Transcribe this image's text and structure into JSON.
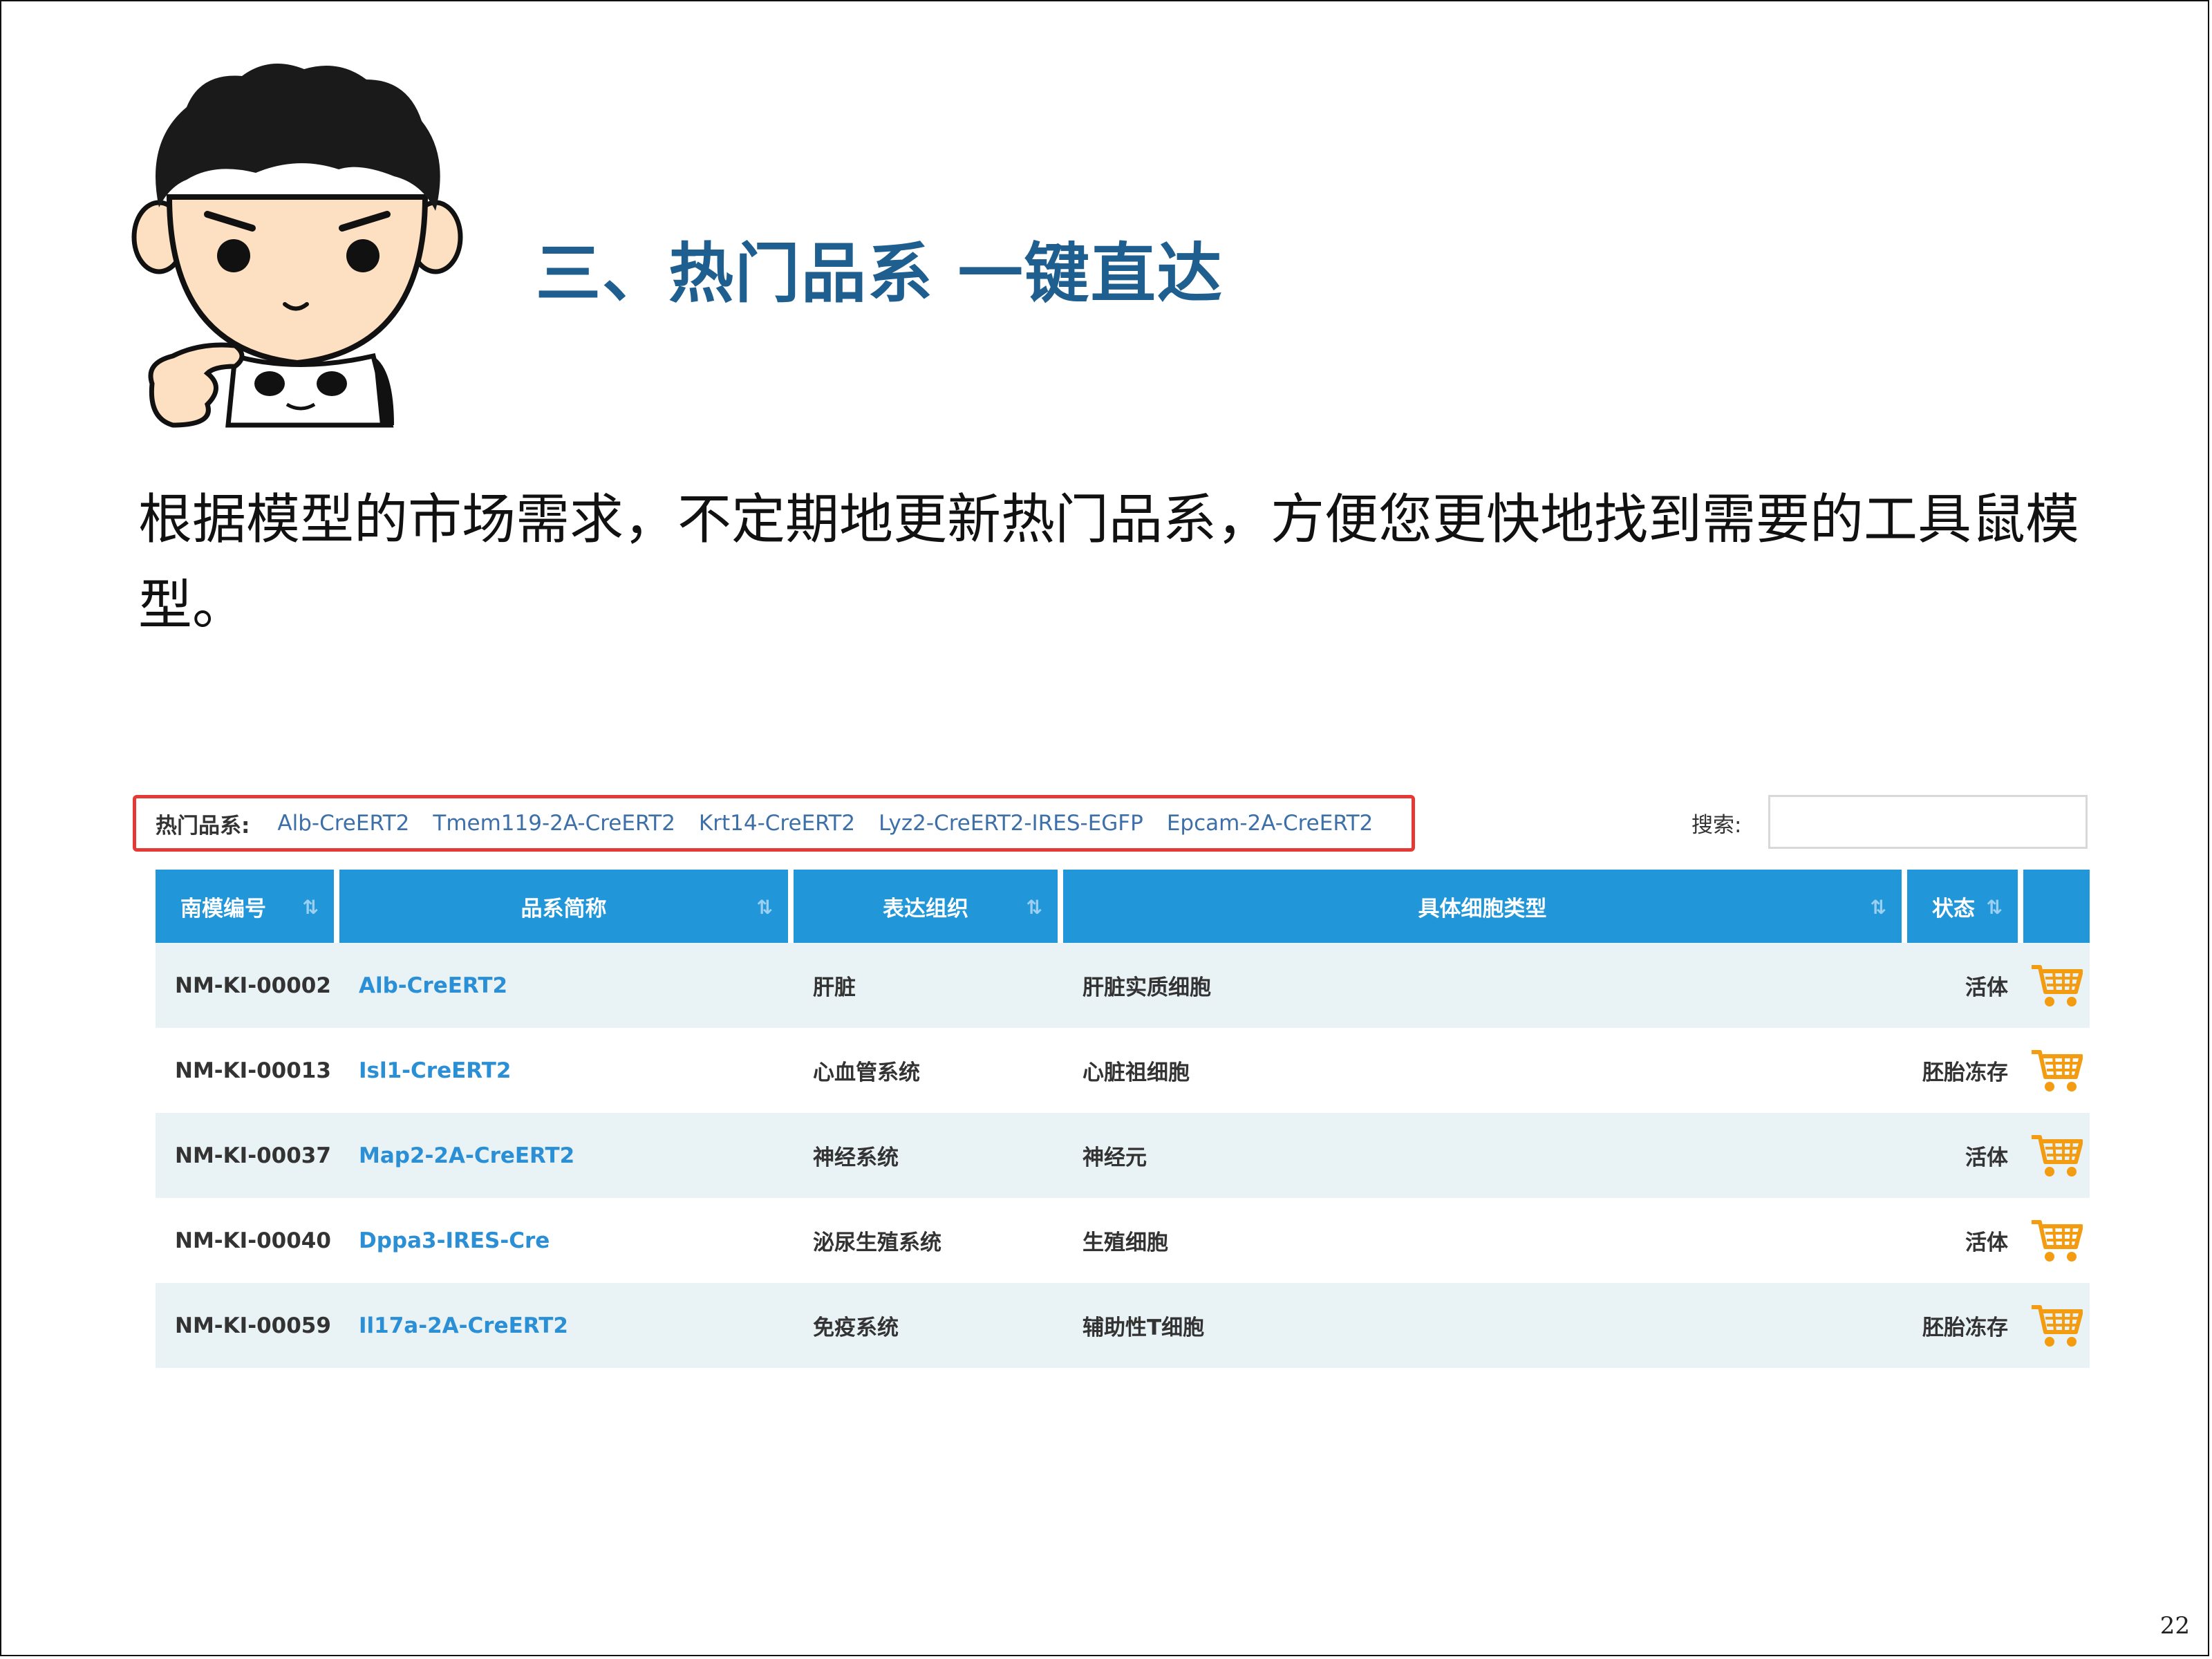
{
  "title": "三、热门品系 一键直达",
  "body_text": "根据模型的市场需求，不定期地更新热门品系，方便您更快地找到需要的工具鼠模型。",
  "hot_strains": {
    "label": "热门品系:",
    "links": [
      "Alb-CreERT2",
      "Tmem119-2A-CreERT2",
      "Krt14-CreERT2",
      "Lyz2-CreERT2-IRES-EGFP",
      "Epcam-2A-CreERT2"
    ]
  },
  "search": {
    "label": "搜索:",
    "value": ""
  },
  "table": {
    "headers": [
      "南模编号",
      "品系简称",
      "表达组织",
      "具体细胞类型",
      "状态"
    ],
    "rows": [
      {
        "id": "NM-KI-00002",
        "name": "Alb-CreERT2",
        "tissue": "肝脏",
        "cell_type": "肝脏实质细胞",
        "state": "活体"
      },
      {
        "id": "NM-KI-00013",
        "name": "Isl1-CreERT2",
        "tissue": "心血管系统",
        "cell_type": "心脏祖细胞",
        "state": "胚胎冻存"
      },
      {
        "id": "NM-KI-00037",
        "name": "Map2-2A-CreERT2",
        "tissue": "神经系统",
        "cell_type": "神经元",
        "state": "活体"
      },
      {
        "id": "NM-KI-00040",
        "name": "Dppa3-IRES-Cre",
        "tissue": "泌尿生殖系统",
        "cell_type": "生殖细胞",
        "state": "活体"
      },
      {
        "id": "NM-KI-00059",
        "name": "Il17a-2A-CreERT2",
        "tissue": "免疫系统",
        "cell_type": "辅助性T细胞",
        "state": "胚胎冻存"
      }
    ]
  },
  "colors": {
    "title": "#1e5f8f",
    "header": "#2196d8",
    "link": "#2b8fd6",
    "cart": "#f39c12",
    "highlight_border": "#e53935"
  },
  "page_number": "22"
}
